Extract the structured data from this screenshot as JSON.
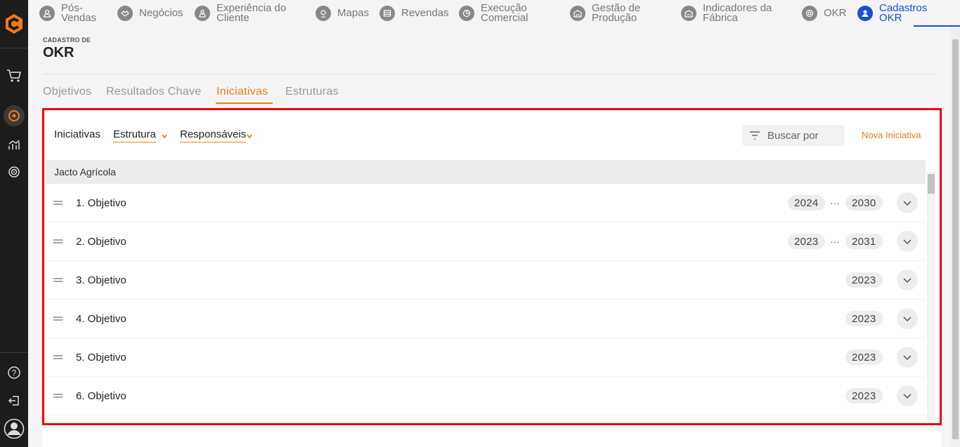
{
  "topnav": {
    "items": [
      {
        "label": "Pós-\nVendas",
        "icon": "person-icon"
      },
      {
        "label": "Negócios",
        "icon": "handshake-icon"
      },
      {
        "label": "Experiência do\nCliente",
        "icon": "customer-icon"
      },
      {
        "label": "Mapas",
        "icon": "map-icon"
      },
      {
        "label": "Revendas",
        "icon": "store-icon"
      },
      {
        "label": "Execução\nComercial",
        "icon": "chart-pie-icon"
      },
      {
        "label": "Gestão de\nProdução",
        "icon": "factory-icon"
      },
      {
        "label": "Indicadores da\nFábrica",
        "icon": "factory-indicator-icon"
      },
      {
        "label": "OKR",
        "icon": "target-icon"
      },
      {
        "label": "Cadastros\nOKR",
        "icon": "user-icon"
      }
    ],
    "active_index": 9
  },
  "header": {
    "crumb": "CADASTRO DE",
    "title": "OKR"
  },
  "tabs": [
    {
      "label": "Objetivos"
    },
    {
      "label": "Resultados Chave"
    },
    {
      "label": "Iniciativas"
    },
    {
      "label": "Estruturas"
    }
  ],
  "active_tab": 2,
  "panel": {
    "section_label": "Iniciativas",
    "filter_structure": "Estrutura",
    "filter_responsibles": "Responsáveis",
    "search_placeholder": "Buscar por",
    "new_button": "Nova Iniciativa",
    "group_label": "Jacto Agrícola",
    "rows": [
      {
        "label": "1. Objetivo",
        "start": "2024",
        "end": "2030"
      },
      {
        "label": "2. Objetivo",
        "start": "2023",
        "end": "2031"
      },
      {
        "label": "3. Objetivo",
        "start": "",
        "end": "2023"
      },
      {
        "label": "4. Objetivo",
        "start": "",
        "end": "2023"
      },
      {
        "label": "5. Objetivo",
        "start": "",
        "end": "2023"
      },
      {
        "label": "6. Objetivo",
        "start": "",
        "end": "2023"
      }
    ],
    "range_separator": "···"
  },
  "colors": {
    "accent": "#f07a1a",
    "nav_active": "#1a4fd1",
    "highlight_border": "#ee0000",
    "rail": "#1c1c1c"
  }
}
